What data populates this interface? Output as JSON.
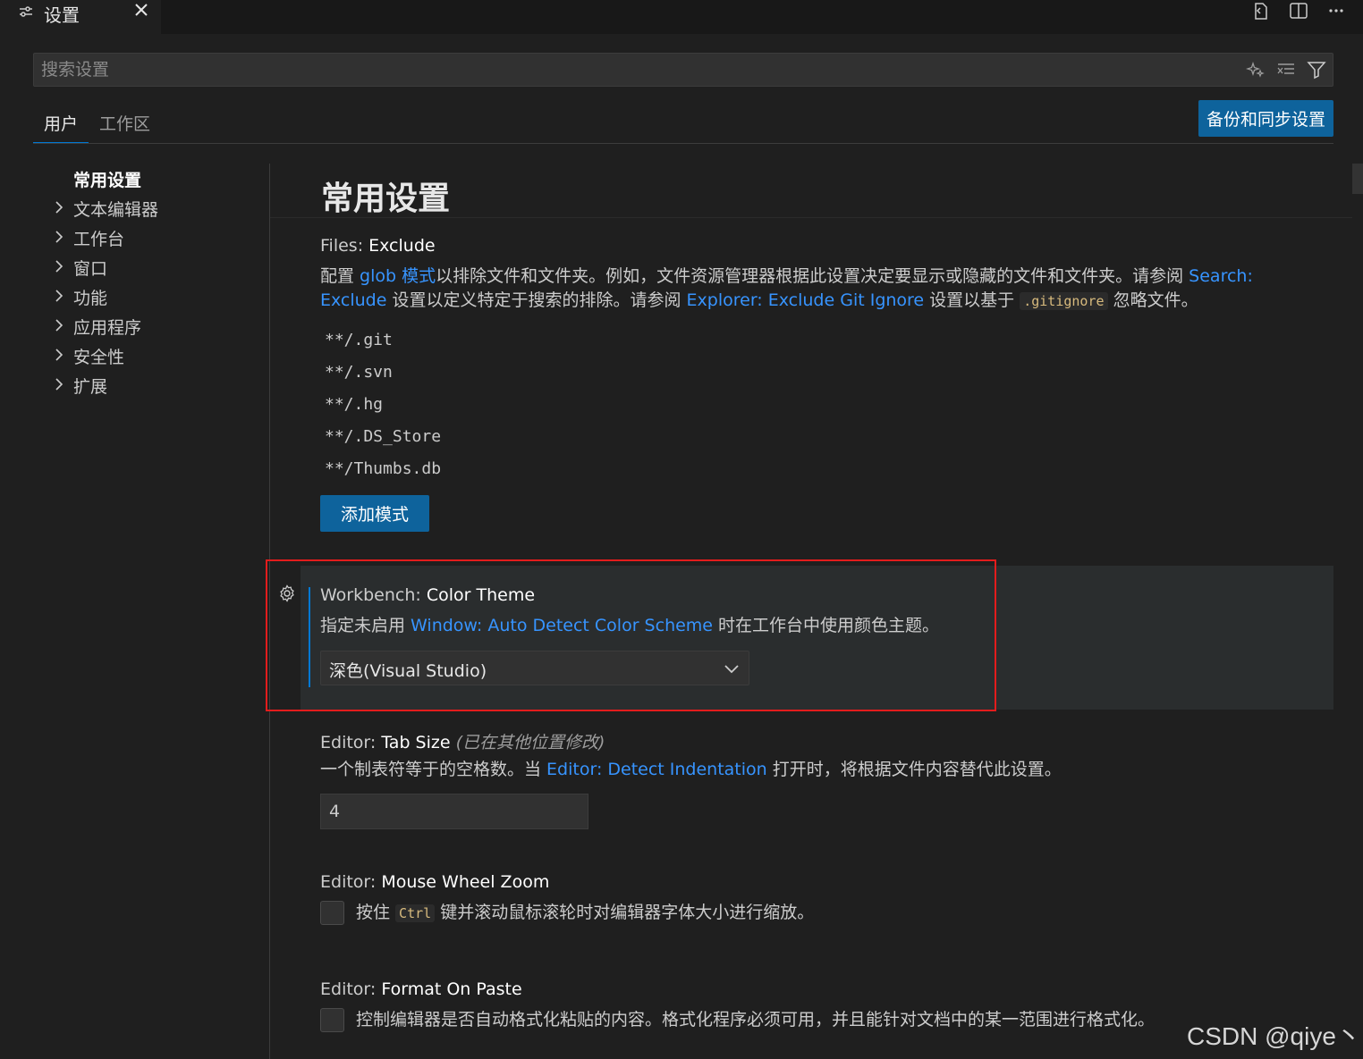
{
  "tab": {
    "label": "设置"
  },
  "search": {
    "placeholder": "搜索设置"
  },
  "scopes": [
    {
      "label": "用户",
      "active": true
    },
    {
      "label": "工作区",
      "active": false
    }
  ],
  "sync_button": "备份和同步设置",
  "toc": [
    {
      "label": "常用设置",
      "active": true,
      "expandable": false
    },
    {
      "label": "文本编辑器",
      "expandable": true
    },
    {
      "label": "工作台",
      "expandable": true
    },
    {
      "label": "窗口",
      "expandable": true
    },
    {
      "label": "功能",
      "expandable": true
    },
    {
      "label": "应用程序",
      "expandable": true
    },
    {
      "label": "安全性",
      "expandable": true
    },
    {
      "label": "扩展",
      "expandable": true
    }
  ],
  "section_title": "常用设置",
  "files_exclude": {
    "category": "Files: ",
    "name": "Exclude",
    "desc_1": "配置 ",
    "link_glob": "glob 模式",
    "desc_2": "以排除文件和文件夹。例如，文件资源管理器根据此设置决定要显示或隐藏的文件和文件夹。请参阅 ",
    "link_search_a": "Search:",
    "link_search_b": "Exclude",
    "desc_3": " 设置以定义特定于搜索的排除。请参阅 ",
    "link_explorer": "Explorer: Exclude Git Ignore",
    "desc_4": " 设置以基于 ",
    "code": ".gitignore",
    "desc_5": " 忽略文件。",
    "patterns": [
      "**/.git",
      "**/.svn",
      "**/.hg",
      "**/.DS_Store",
      "**/Thumbs.db"
    ],
    "add_button": "添加模式"
  },
  "color_theme": {
    "category": "Workbench: ",
    "name": "Color Theme",
    "desc_1": "指定未启用 ",
    "link": "Window: Auto Detect Color Scheme",
    "desc_2": " 时在工作台中使用颜色主题。",
    "value": "深色(Visual Studio)"
  },
  "tab_size": {
    "category": "Editor: ",
    "name": "Tab Size",
    "modified": "(已在其他位置修改)",
    "desc_1": "一个制表符等于的空格数。当 ",
    "link": "Editor: Detect Indentation",
    "desc_2": " 打开时，将根据文件内容替代此设置。",
    "value": "4"
  },
  "mouse_wheel_zoom": {
    "category": "Editor: ",
    "name": "Mouse Wheel Zoom",
    "desc_1": "按住 ",
    "code": "Ctrl",
    "desc_2": " 键并滚动鼠标滚轮时对编辑器字体大小进行缩放。",
    "checked": false
  },
  "format_on_paste": {
    "category": "Editor: ",
    "name": "Format On Paste",
    "desc": "控制编辑器是否自动格式化粘贴的内容。格式化程序必须可用，并且能针对文档中的某一范围进行格式化。",
    "checked": false
  },
  "watermark": "CSDN @qiye丶",
  "colors": {
    "accent": "#0078d4",
    "button": "#0e639c",
    "link": "#3794ff",
    "highlight": "#e31c1c"
  }
}
